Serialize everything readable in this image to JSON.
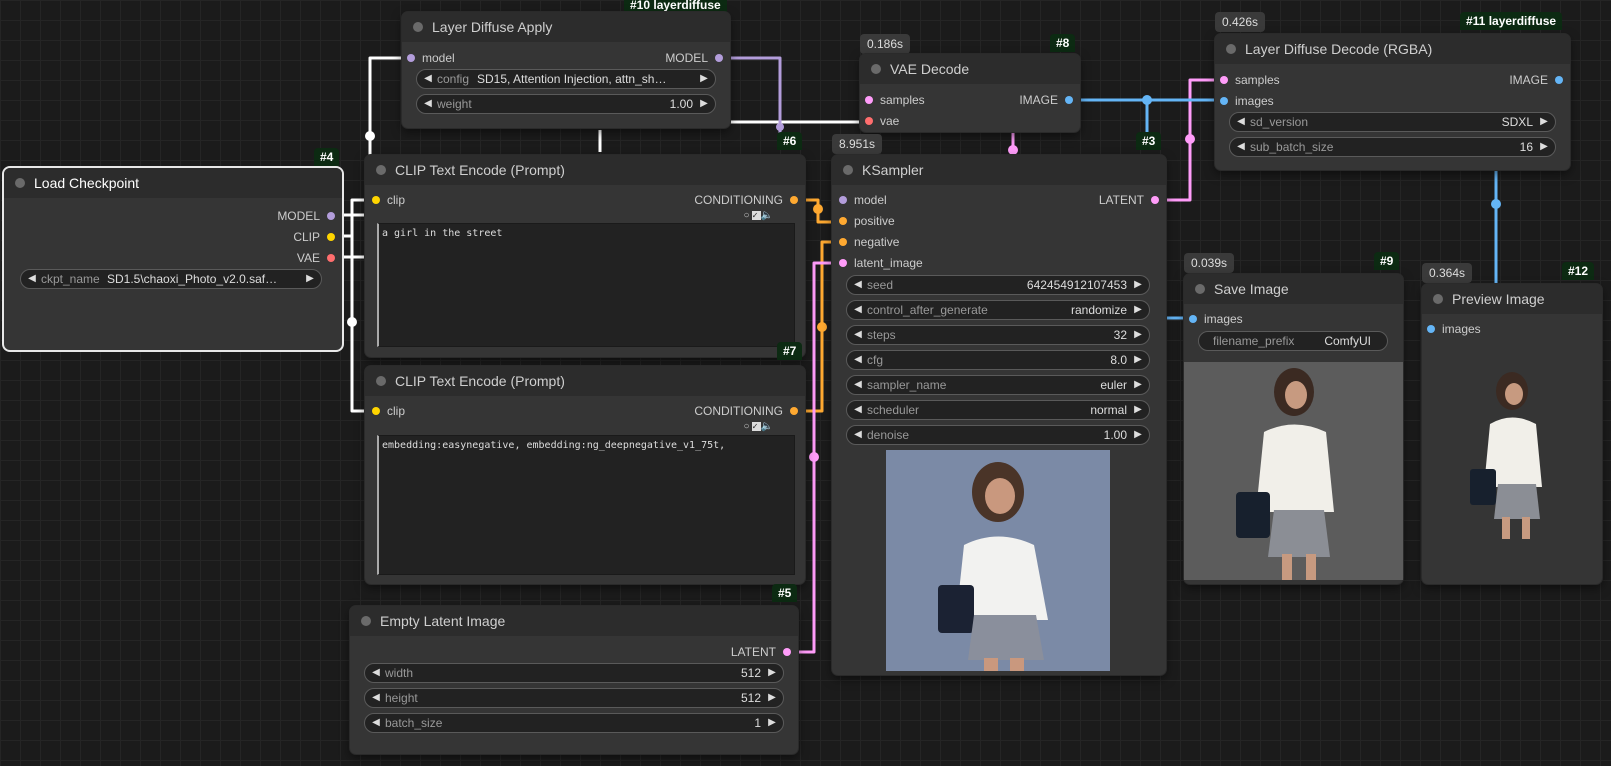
{
  "colors": {
    "model": "#b39ddb",
    "clip": "#ffd500",
    "vae": "#ff6e6e",
    "conditioning": "#ffa931",
    "latent": "#ff9cf9",
    "image": "#64b5f6",
    "link_white": "#ffffff"
  },
  "nodes": {
    "layer_diffuse_apply": {
      "badge": "#10 layerdiffuse",
      "title": "Layer Diffuse Apply",
      "input_model": "model",
      "output_model": "MODEL",
      "config_label": "config",
      "config_value": "SD15, Attention Injection, attn_sh…",
      "weight_label": "weight",
      "weight_value": "1.00"
    },
    "vae_decode": {
      "timer": "0.186s",
      "badge": "#8",
      "title": "VAE Decode",
      "input_samples": "samples",
      "input_vae": "vae",
      "output_image": "IMAGE"
    },
    "layer_diffuse_decode": {
      "timer": "0.426s",
      "badge": "#11 layerdiffuse",
      "title": "Layer Diffuse Decode (RGBA)",
      "input_samples": "samples",
      "input_images": "images",
      "output_image": "IMAGE",
      "sd_version_label": "sd_version",
      "sd_version_value": "SDXL",
      "sub_batch_label": "sub_batch_size",
      "sub_batch_value": "16"
    },
    "load_checkpoint": {
      "badge": "#4",
      "title": "Load Checkpoint",
      "output_model": "MODEL",
      "output_clip": "CLIP",
      "output_vae": "VAE",
      "ckpt_label": "ckpt_name",
      "ckpt_value": "SD1.5\\chaoxi_Photo_v2.0.saf…"
    },
    "clip_encode_pos": {
      "badge": "#6",
      "title": "CLIP Text Encode (Prompt)",
      "input_clip": "clip",
      "output_conditioning": "CONDITIONING",
      "text": "a girl in the street"
    },
    "clip_encode_neg": {
      "badge": "#7",
      "title": "CLIP Text Encode (Prompt)",
      "input_clip": "clip",
      "output_conditioning": "CONDITIONING",
      "text": "embedding:easynegative, embedding:ng_deepnegative_v1_75t,"
    },
    "empty_latent": {
      "badge": "#5",
      "title": "Empty Latent Image",
      "output_latent": "LATENT",
      "width_label": "width",
      "width_value": "512",
      "height_label": "height",
      "height_value": "512",
      "batch_label": "batch_size",
      "batch_value": "1"
    },
    "ksampler": {
      "timer": "8.951s",
      "badge": "#3",
      "title": "KSampler",
      "input_model": "model",
      "input_positive": "positive",
      "input_negative": "negative",
      "input_latent": "latent_image",
      "output_latent": "LATENT",
      "widgets": [
        {
          "label": "seed",
          "value": "642454912107453"
        },
        {
          "label": "control_after_generate",
          "value": "randomize"
        },
        {
          "label": "steps",
          "value": "32"
        },
        {
          "label": "cfg",
          "value": "8.0"
        },
        {
          "label": "sampler_name",
          "value": "euler"
        },
        {
          "label": "scheduler",
          "value": "normal"
        },
        {
          "label": "denoise",
          "value": "1.00"
        }
      ]
    },
    "save_image": {
      "timer": "0.039s",
      "badge": "#9",
      "title": "Save Image",
      "input_images": "images",
      "prefix_label": "filename_prefix",
      "prefix_value": "ComfyUI"
    },
    "preview_image": {
      "timer": "0.364s",
      "badge": "#12",
      "title": "Preview Image",
      "input_images": "images"
    }
  }
}
